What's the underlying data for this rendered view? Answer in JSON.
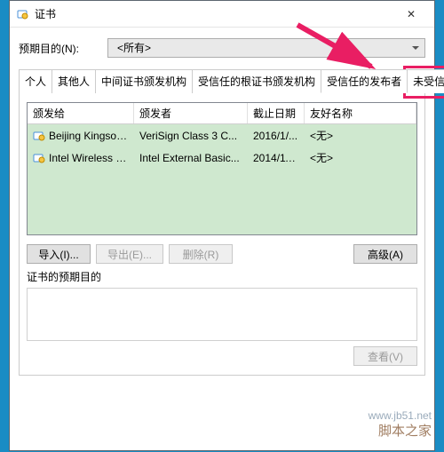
{
  "window": {
    "title": "证书",
    "close_glyph": "✕"
  },
  "purpose": {
    "label": "预期目的(N):",
    "value": "<所有>"
  },
  "tabs": [
    {
      "label": "个人"
    },
    {
      "label": "其他人"
    },
    {
      "label": "中间证书颁发机构"
    },
    {
      "label": "受信任的根证书颁发机构"
    },
    {
      "label": "受信任的发布者",
      "active": true
    },
    {
      "label": "未受信任的发布者",
      "highlighted": true
    }
  ],
  "columns": [
    "颁发给",
    "颁发者",
    "截止日期",
    "友好名称"
  ],
  "rows": [
    {
      "issued_to": "Beijing Kingsoft ...",
      "issuer": "VeriSign Class 3 C...",
      "expires": "2016/1/...",
      "friendly": "<无>"
    },
    {
      "issued_to": "Intel Wireless Di...",
      "issuer": "Intel External Basic...",
      "expires": "2014/11...",
      "friendly": "<无>"
    }
  ],
  "buttons": {
    "import": "导入(I)...",
    "export": "导出(E)...",
    "remove": "删除(R)",
    "advanced": "高级(A)",
    "view": "查看(V)"
  },
  "sections": {
    "intended_purposes": "证书的预期目的"
  },
  "watermark": {
    "line1": "www.jb51.net",
    "line2": "脚本之家"
  }
}
